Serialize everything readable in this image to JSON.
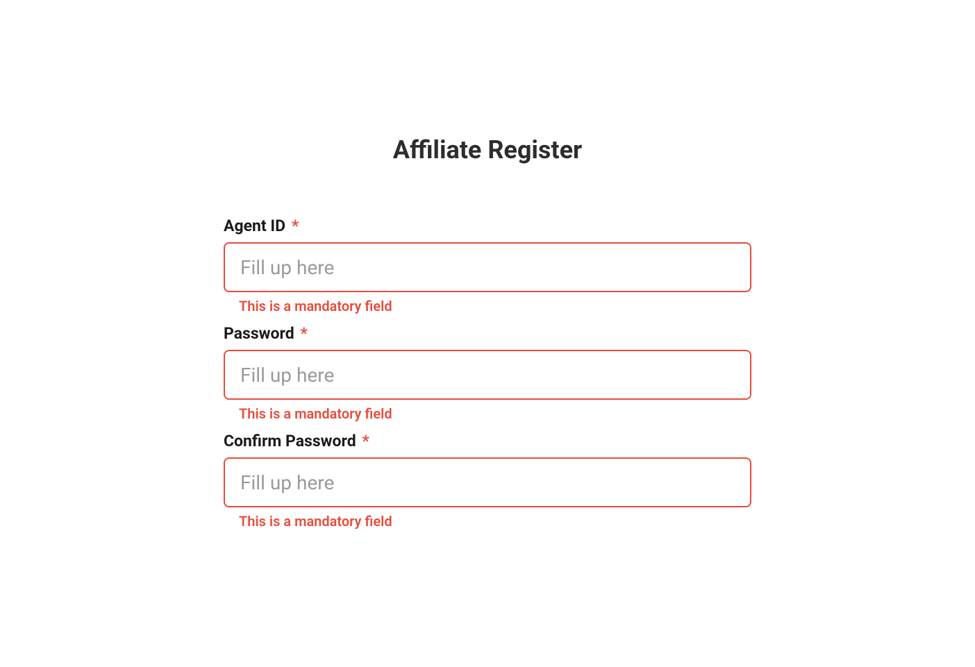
{
  "page": {
    "title": "Affiliate Register"
  },
  "form": {
    "fields": {
      "agent_id": {
        "label": "Agent ID",
        "required_mark": "*",
        "placeholder": "Fill up here",
        "value": "",
        "error": "This is a mandatory field"
      },
      "password": {
        "label": "Password",
        "required_mark": "*",
        "placeholder": "Fill up here",
        "value": "",
        "error": "This is a mandatory field"
      },
      "confirm_password": {
        "label": "Confirm Password",
        "required_mark": "*",
        "placeholder": "Fill up here",
        "value": "",
        "error": "This is a mandatory field"
      }
    }
  }
}
